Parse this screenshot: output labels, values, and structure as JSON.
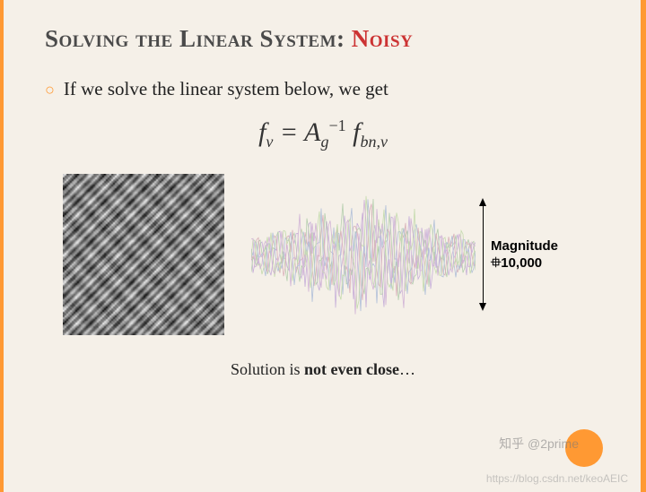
{
  "title": {
    "main": "Solving the Linear System: ",
    "accent": "Noisy"
  },
  "bullet": "If we solve the linear system below, we get",
  "equation": {
    "lhs_base": "f",
    "lhs_sub": "v",
    "eq_sign": " = ",
    "A_base": "A",
    "A_sub": "g",
    "A_sup": "−1",
    "rhs_base": " f",
    "rhs_sub": "bn,v"
  },
  "magnitude": {
    "label": "Magnitude",
    "value": "⯐10,000"
  },
  "caption": {
    "pre": "Solution is ",
    "strong": "not even close",
    "post": "…"
  },
  "watermarks": {
    "zhihu": "知乎 @2prime",
    "csdn": "https://blog.csdn.net/keoAEIC"
  }
}
